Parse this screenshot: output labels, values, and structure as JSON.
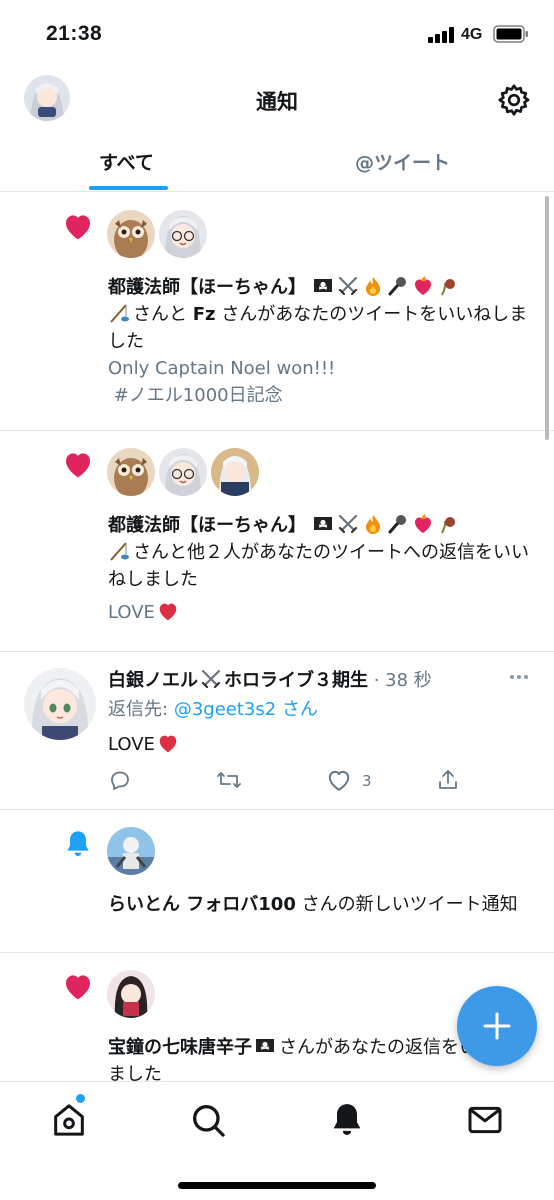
{
  "status_bar": {
    "time": "21:38",
    "network": "4G"
  },
  "header": {
    "title": "通知"
  },
  "tabs": [
    {
      "label": "すべて",
      "active": true
    },
    {
      "label": "@ツイート",
      "active": false
    }
  ],
  "colors": {
    "accent": "#1da1f2",
    "like": "#e0245e",
    "secondary_text": "#657786"
  },
  "notifications": [
    {
      "type": "like",
      "icon": "heart-icon",
      "actor_name": "都護法師【ほーちゃん】",
      "text_mid": "さんと",
      "second_actor": "Fz",
      "text_end": "さんがあなたのツイートをいいねしました",
      "snippet_line1": "Only Captain Noel won!!!",
      "snippet_line2": " #ノエル1000日記念"
    },
    {
      "type": "like",
      "icon": "heart-icon",
      "actor_name": "都護法師【ほーちゃん】",
      "text_end": "さんと他２人があなたのツイートへの返信をいいねしました",
      "snippet": "LOVE"
    },
    {
      "type": "tweet",
      "author_name": "白銀ノエル",
      "author_suffix": "ホロライブ３期生",
      "timestamp": "38 秒",
      "reply_prefix": "返信先:",
      "reply_handle": "@3geet3s2",
      "reply_suffix": "さん",
      "body": "LOVE",
      "like_count": "3"
    },
    {
      "type": "new_tweet",
      "icon": "bell-icon",
      "actor_name": "らいとん フォロバ100",
      "text_end": "さんの新しいツイート通知"
    },
    {
      "type": "like",
      "icon": "heart-icon",
      "actor_name": "宝鐘の七味唐辛子",
      "text_end": "さんがあなたの返信をいいねしました"
    }
  ]
}
